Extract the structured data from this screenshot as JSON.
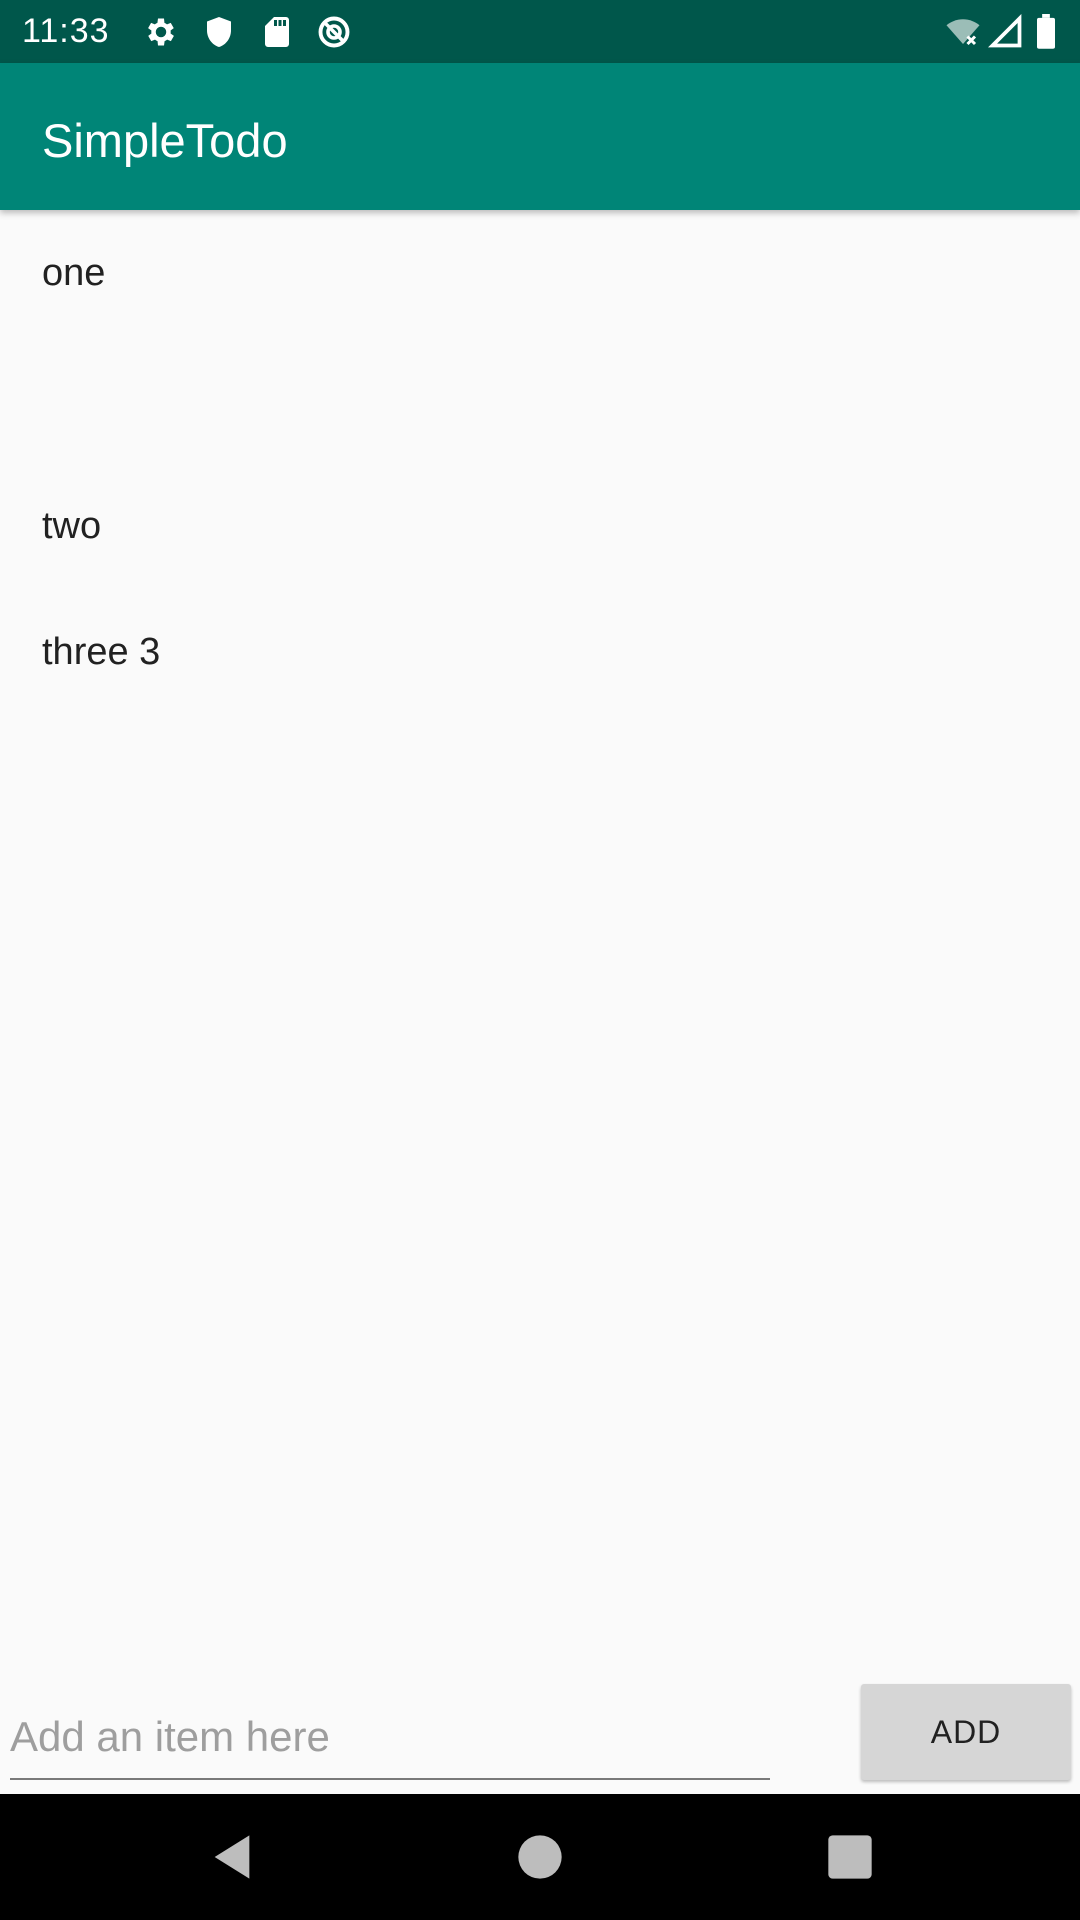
{
  "status_bar": {
    "time": "11:33",
    "icons": [
      "settings-icon",
      "shield-icon",
      "sd-card-icon",
      "sync-icon",
      "wifi-icon",
      "signal-icon",
      "battery-icon"
    ]
  },
  "app_bar": {
    "title": "SimpleTodo",
    "color": "#008577",
    "status_color": "#00574b"
  },
  "todo_list": {
    "items": [
      {
        "label": "one"
      },
      {
        "label": "two"
      },
      {
        "label": "three 3"
      }
    ]
  },
  "add_row": {
    "input_value": "",
    "input_placeholder": "Add an item here",
    "button_label": "ADD"
  },
  "nav_bar": {
    "icons": [
      "back-icon",
      "home-icon",
      "recents-icon"
    ]
  }
}
